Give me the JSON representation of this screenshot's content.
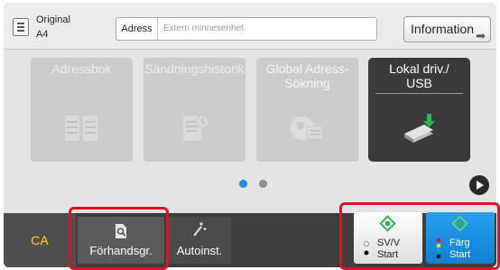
{
  "header": {
    "original_label": "Original",
    "original_size": "A4",
    "address_label": "Adress",
    "address_placeholder": "Extern minnesenhet",
    "information_label": "Information"
  },
  "tiles": [
    {
      "label": "Adressbok",
      "state": "disabled",
      "icon": "address-book-icon"
    },
    {
      "label": "Sändningshistorik",
      "state": "disabled",
      "icon": "history-icon"
    },
    {
      "label": "Global Adress-\nSökning",
      "state": "disabled",
      "icon": "global-search-icon"
    },
    {
      "label": "Lokal driv./\nUSB",
      "state": "active",
      "icon": "usb-drive-icon"
    }
  ],
  "pager": {
    "current": 1,
    "total": 2
  },
  "bottom_bar": {
    "ca_label": "CA",
    "preview_label": "Förhandsgr.",
    "autoset_label": "Autoinst.",
    "bw_start_label": "SV/V\nStart",
    "color_start_label": "Färg\nStart"
  },
  "colors": {
    "accent_blue": "#1a8fe3",
    "highlight_red": "#d6142b",
    "start_green": "#35b24a",
    "ca_yellow": "#ffd51a"
  }
}
